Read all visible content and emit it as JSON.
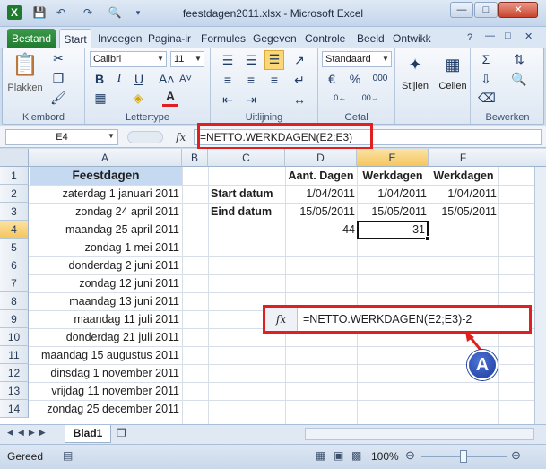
{
  "window": {
    "title": "feestdagen2011.xlsx - Microsoft Excel"
  },
  "ribbon": {
    "tabs": [
      "Bestand",
      "Start",
      "Invoegen",
      "Pagina-ir",
      "Formules",
      "Gegeven",
      "Controle",
      "Beeld",
      "Ontwikk"
    ],
    "font_name": "Calibri",
    "font_size": "11",
    "number_format": "Standaard",
    "groups": {
      "clipboard": "Klembord",
      "font": "Lettertype",
      "alignment": "Uitlijning",
      "number": "Getal",
      "edit": "Bewerken"
    },
    "paste_label": "Plakken",
    "styles_label": "Stijlen",
    "cells_label": "Cellen",
    "bold": "B",
    "italic": "I",
    "underline": "U",
    "font_color_glyph": "A",
    "percent": "%",
    "thousands": "000"
  },
  "formula_bar": {
    "name_box": "E4",
    "fx": "fx",
    "formula": "=NETTO.WERKDAGEN(E2;E3)"
  },
  "columns": [
    "A",
    "B",
    "C",
    "D",
    "E",
    "F"
  ],
  "rows": [
    "1",
    "2",
    "3",
    "4",
    "5",
    "6",
    "7",
    "8",
    "9",
    "10",
    "11",
    "12",
    "13",
    "14"
  ],
  "cells": {
    "A1": "Feestdagen",
    "A2": "zaterdag 1 januari 2011",
    "A3": "zondag 24 april 2011",
    "A4": "maandag 25 april 2011",
    "A5": "zondag 1 mei 2011",
    "A6": "donderdag 2 juni 2011",
    "A7": "zondag 12 juni 2011",
    "A8": "maandag 13 juni 2011",
    "A9": "maandag 11 juli 2011",
    "A10": "donderdag 21 juli 2011",
    "A11": "maandag 15 augustus 2011",
    "A12": "dinsdag 1 november 2011",
    "A13": "vrijdag 11 november 2011",
    "A14": "zondag 25 december 2011",
    "C2": "Start datum",
    "C3": "Eind datum",
    "D1": "Aant. Dagen",
    "D2": "1/04/2011",
    "D3": "15/05/2011",
    "D4": "44",
    "E1": "Werkdagen",
    "E2": "1/04/2011",
    "E3": "15/05/2011",
    "E4": "31",
    "F1": "Werkdagen",
    "F2": "1/04/2011",
    "F3": "15/05/2011"
  },
  "callout": {
    "fx": "fx",
    "formula": "=NETTO.WERKDAGEN(E2;E3)-2",
    "badge": "A"
  },
  "sheet_tab": "Blad1",
  "status": {
    "ready": "Gereed",
    "zoom": "100%"
  },
  "colors": {
    "annotation_red": "#e02020",
    "badge_blue": "#1c3d9c",
    "file_tab_green": "#1f7a2e"
  }
}
